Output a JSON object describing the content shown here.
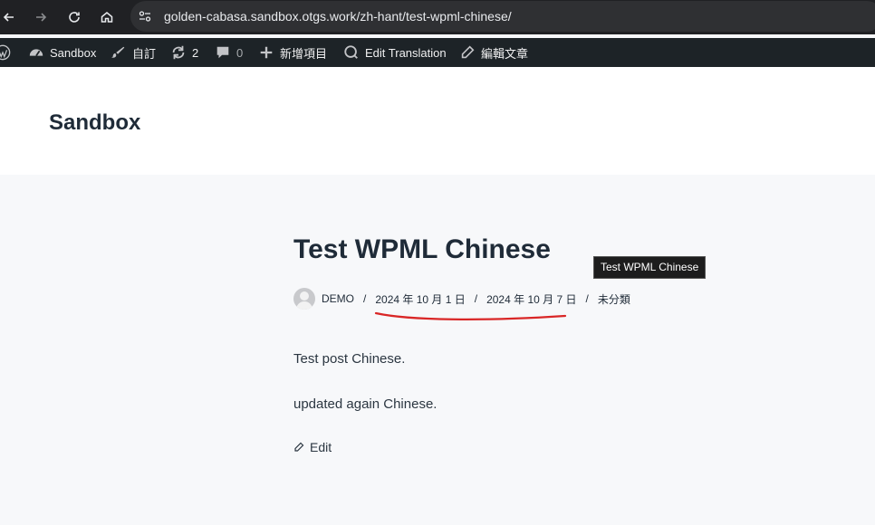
{
  "browser": {
    "url": "golden-cabasa.sandbox.otgs.work/zh-hant/test-wpml-chinese/"
  },
  "adminbar": {
    "site_name": "Sandbox",
    "customize": "自訂",
    "updates_count": "2",
    "comments_count": "0",
    "new_item": "新增項目",
    "edit_translation": "Edit Translation",
    "edit_post": "編輯文章"
  },
  "site": {
    "title": "Sandbox"
  },
  "post": {
    "title": "Test WPML Chinese",
    "tooltip": "Test WPML Chinese",
    "author": "DEMO",
    "published": "2024 年 10 月 1 日",
    "modified": "2024 年 10 月 7 日",
    "category": "未分類",
    "separator": "/",
    "paragraphs": [
      "Test post Chinese.",
      "updated again Chinese."
    ],
    "edit_label": "Edit"
  },
  "colors": {
    "annotation": "#d92626",
    "adminbar_bg": "#1d2327",
    "browser_bg": "#202124"
  }
}
